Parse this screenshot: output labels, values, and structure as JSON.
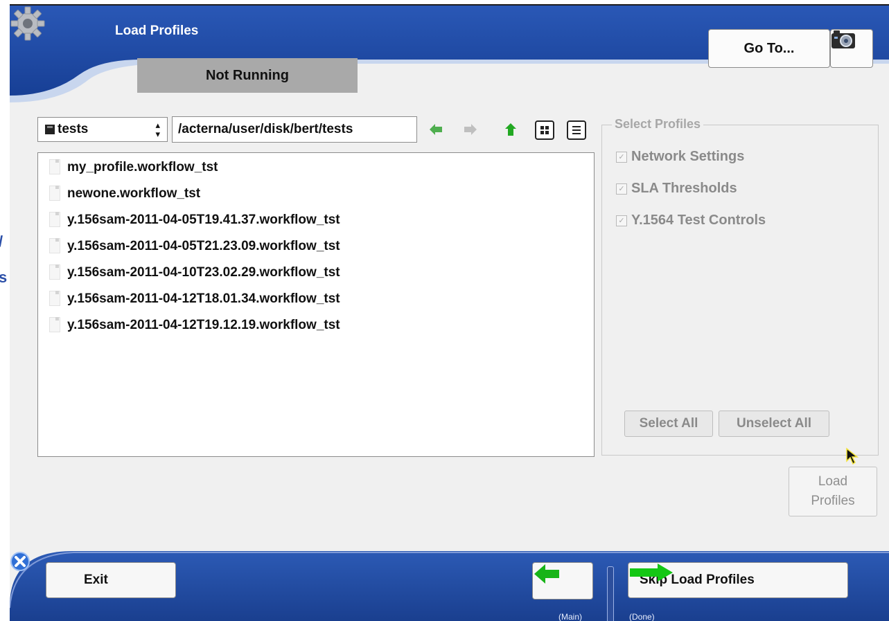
{
  "edge_text": [
    "/",
    "s"
  ],
  "header": {
    "title": "Load Profiles",
    "status": "Not Running",
    "goto_label": "Go To...",
    "icons": [
      "gear-icon",
      "camera-icon"
    ]
  },
  "browser": {
    "drive": "tests",
    "path": "/acterna/user/disk/bert/tests",
    "nav_icons": [
      "back-arrow-icon",
      "forward-arrow-icon",
      "up-arrow-icon",
      "icon-view-icon",
      "list-view-icon"
    ],
    "files": [
      "my_profile.workflow_tst",
      "newone.workflow_tst",
      "y.156sam-2011-04-05T19.41.37.workflow_tst",
      "y.156sam-2011-04-05T21.23.09.workflow_tst",
      "y.156sam-2011-04-10T23.02.29.workflow_tst",
      "y.156sam-2011-04-12T18.01.34.workflow_tst",
      "y.156sam-2011-04-12T19.12.19.workflow_tst"
    ]
  },
  "select_profiles": {
    "title": "Select Profiles",
    "options": [
      {
        "label": "Network Settings",
        "checked": true
      },
      {
        "label": "SLA Thresholds",
        "checked": true
      },
      {
        "label": "Y.1564 Test Controls",
        "checked": true
      }
    ],
    "select_all": "Select All",
    "unselect_all": "Unselect All"
  },
  "load_button": {
    "line1": "Load",
    "line2": "Profiles"
  },
  "footer": {
    "exit_label": "Exit",
    "back_hint": "(Main)",
    "skip_label": "Skip Load Profiles",
    "skip_hint": "(Done)"
  },
  "colors": {
    "header_blue": "#1f4ba5",
    "accent_green": "#12b512",
    "muted_text": "#8a8a8a"
  }
}
